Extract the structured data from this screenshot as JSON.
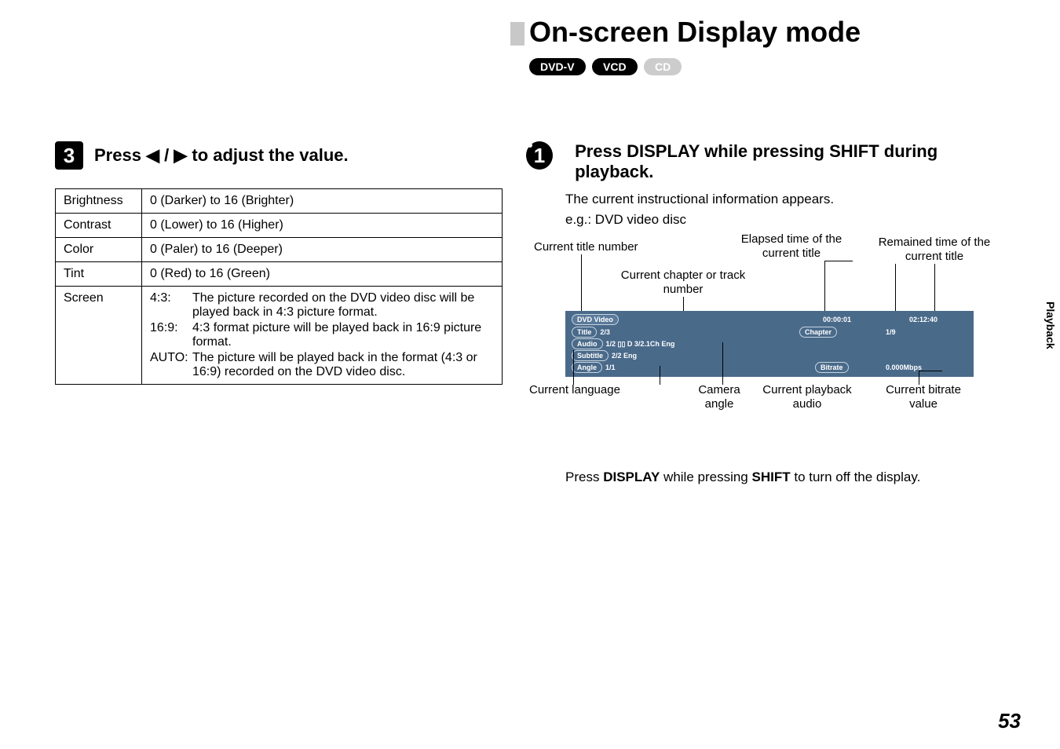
{
  "sideTab": "Playback",
  "header": {
    "title": "On-screen Display mode",
    "badges": [
      {
        "label": "DVD-V",
        "style": "dark"
      },
      {
        "label": "VCD",
        "style": "dark"
      },
      {
        "label": "CD",
        "style": "light"
      }
    ]
  },
  "step3": {
    "num": "3",
    "textPrefix": "Press ",
    "arrows": "◀ / ▶",
    "textSuffix": " to adjust the value.",
    "rows": {
      "brightness": {
        "label": "Brightness",
        "value": "0 (Darker) to 16 (Brighter)"
      },
      "contrast": {
        "label": "Contrast",
        "value": "0 (Lower) to 16 (Higher)"
      },
      "color": {
        "label": "Color",
        "value": "0 (Paler) to 16 (Deeper)"
      },
      "tint": {
        "label": "Tint",
        "value": "0 (Red) to 16 (Green)"
      },
      "screen": {
        "label": "Screen"
      }
    },
    "screenOptions": {
      "r43": {
        "key": "4:3:",
        "desc": "The picture recorded on the DVD video disc will be played back in 4:3 picture format."
      },
      "r169": {
        "key": "16:9:",
        "desc": "4:3 format picture will be played back in 16:9 picture format."
      },
      "auto": {
        "key": "AUTO:",
        "desc": "The picture will be played back in the format (4:3 or 16:9) recorded on the DVD video disc."
      }
    }
  },
  "step1": {
    "num": "1",
    "title": "Press DISPLAY while pressing SHIFT during playback.",
    "body": "The current instructional information appears.",
    "eg": "e.g.: DVD video disc"
  },
  "labels": {
    "titleNum": "Current title number",
    "elapsed": "Elapsed time of the current title",
    "remained": "Remained time of the current title",
    "chapterTrack": "Current chapter or track number",
    "lang": "Current language",
    "angle": "Camera angle",
    "audio": "Current playback audio",
    "bitrate": "Current bitrate value"
  },
  "osd": {
    "hdr": "DVD Video",
    "titleLbl": "Title",
    "titleVal": "2/3",
    "chapterLbl": "Chapter",
    "chapterVal": "1/9",
    "elapsedVal": "00:00:01",
    "remainVal": "02:12:40",
    "audioLbl": "Audio",
    "audioVal": "1/2 ▯▯ D 3/2.1Ch Eng",
    "subLbl": "Subtitle",
    "subVal": "2/2 Eng",
    "angleLbl": "Angle",
    "angleVal": "1/1",
    "bitrateLbl": "Bitrate",
    "bitrateVal": "0.000Mbps"
  },
  "displayOff": {
    "p1": "Press ",
    "k1": "DISPLAY",
    "p2": " while pressing ",
    "k2": "SHIFT",
    "p3": " to turn off the display."
  },
  "pageNum": "53"
}
